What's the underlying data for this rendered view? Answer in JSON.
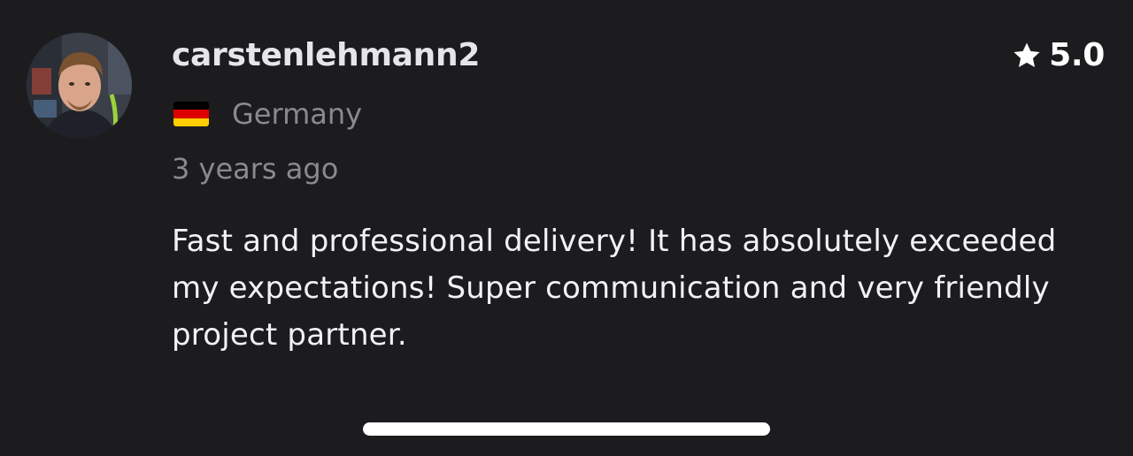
{
  "review": {
    "username": "carstenlehmann2",
    "rating": "5.0",
    "country": "Germany",
    "timestamp": "3 years ago",
    "text": "Fast and professional delivery! It has absolutely exceeded my expectations! Super communication and very friendly project partner."
  },
  "icons": {
    "rating": "star-icon",
    "flag": "germany-flag-icon"
  },
  "colors": {
    "background": "#1c1c1e",
    "username": "#e6e6e8",
    "muted_text": "#8a8a8e",
    "body_text": "#f2f2f4",
    "flag_black": "#000000",
    "flag_red": "#dd0000",
    "flag_gold": "#ffce00"
  }
}
